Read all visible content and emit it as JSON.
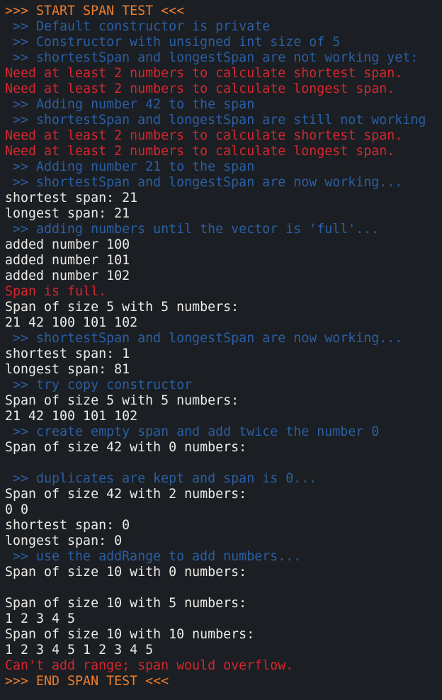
{
  "terminal": {
    "colors": {
      "background": "#1b1f23",
      "orange": "#ee7c2a",
      "blue": "#2b5ea3",
      "red": "#d7262e",
      "white": "#eceae6"
    },
    "lines": [
      {
        "text": ">>> START SPAN TEST <<<",
        "color": "orange"
      },
      {
        "text": " >> Default constructor is private",
        "color": "blue"
      },
      {
        "text": " >> Constructor with unsigned int size of 5",
        "color": "blue"
      },
      {
        "text": " >> shortestSpan and longestSpan are not working yet:",
        "color": "blue"
      },
      {
        "text": "Need at least 2 numbers to calculate shortest span.",
        "color": "red"
      },
      {
        "text": "Need at least 2 numbers to calculate longest span.",
        "color": "red"
      },
      {
        "text": " >> Adding number 42 to the span",
        "color": "blue"
      },
      {
        "text": " >> shortestSpan and longestSpan are still not working",
        "color": "blue"
      },
      {
        "text": "Need at least 2 numbers to calculate shortest span.",
        "color": "red"
      },
      {
        "text": "Need at least 2 numbers to calculate longest span.",
        "color": "red"
      },
      {
        "text": " >> Adding number 21 to the span",
        "color": "blue"
      },
      {
        "text": " >> shortestSpan and longestSpan are now working...",
        "color": "blue"
      },
      {
        "text": "shortest span: 21",
        "color": "white"
      },
      {
        "text": "longest span: 21",
        "color": "white"
      },
      {
        "text": " >> adding numbers until the vector is 'full'...",
        "color": "blue"
      },
      {
        "text": "added number 100",
        "color": "white"
      },
      {
        "text": "added number 101",
        "color": "white"
      },
      {
        "text": "added number 102",
        "color": "white"
      },
      {
        "text": "Span is full.",
        "color": "red"
      },
      {
        "text": "Span of size 5 with 5 numbers:",
        "color": "white"
      },
      {
        "text": "21 42 100 101 102",
        "color": "white"
      },
      {
        "text": " >> shortestSpan and longestSpan are now working...",
        "color": "blue"
      },
      {
        "text": "shortest span: 1",
        "color": "white"
      },
      {
        "text": "longest span: 81",
        "color": "white"
      },
      {
        "text": " >> try copy constructor",
        "color": "blue"
      },
      {
        "text": "Span of size 5 with 5 numbers:",
        "color": "white"
      },
      {
        "text": "21 42 100 101 102",
        "color": "white"
      },
      {
        "text": " >> create empty span and add twice the number 0",
        "color": "blue"
      },
      {
        "text": "Span of size 42 with 0 numbers:",
        "color": "white"
      },
      {
        "text": "",
        "color": "white"
      },
      {
        "text": " >> duplicates are kept and span is 0...",
        "color": "blue"
      },
      {
        "text": "Span of size 42 with 2 numbers:",
        "color": "white"
      },
      {
        "text": "0 0",
        "color": "white"
      },
      {
        "text": "shortest span: 0",
        "color": "white"
      },
      {
        "text": "longest span: 0",
        "color": "white"
      },
      {
        "text": " >> use the addRange to add numbers...",
        "color": "blue"
      },
      {
        "text": "Span of size 10 with 0 numbers:",
        "color": "white"
      },
      {
        "text": "",
        "color": "white"
      },
      {
        "text": "Span of size 10 with 5 numbers:",
        "color": "white"
      },
      {
        "text": "1 2 3 4 5",
        "color": "white"
      },
      {
        "text": "Span of size 10 with 10 numbers:",
        "color": "white"
      },
      {
        "text": "1 2 3 4 5 1 2 3 4 5",
        "color": "white"
      },
      {
        "text": "Can't add range; span would overflow.",
        "color": "red"
      },
      {
        "text": ">>> END SPAN TEST <<<",
        "color": "orange"
      }
    ]
  }
}
